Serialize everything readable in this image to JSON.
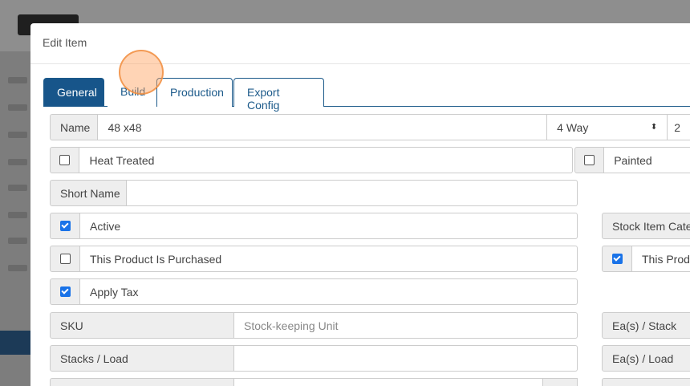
{
  "modal": {
    "title": "Edit Item"
  },
  "tabs": [
    {
      "label": "General",
      "active": true
    },
    {
      "label": "Build",
      "active": false
    },
    {
      "label": "Production",
      "active": false
    },
    {
      "label": "Export Config",
      "active": false
    }
  ],
  "form": {
    "name_label": "Name",
    "name_value": "48 x48",
    "type_select": "4 Way",
    "extra_value": "2",
    "heat_treated_label": "Heat Treated",
    "heat_treated_checked": false,
    "painted_label": "Painted",
    "painted_checked": false,
    "short_name_label": "Short Name",
    "short_name_value": "",
    "active_label": "Active",
    "active_checked": true,
    "stock_item_category_label": "Stock Item Categ",
    "purchased_label": "This Product Is Purchased",
    "purchased_checked": false,
    "this_product_right_label": "This Produ",
    "this_product_right_checked": true,
    "apply_tax_label": "Apply Tax",
    "apply_tax_checked": true,
    "sku_label": "SKU",
    "sku_placeholder": "Stock-keeping Unit",
    "eas_stack_label": "Ea(s) / Stack",
    "stacks_load_label": "Stacks / Load",
    "stacks_load_value": "",
    "eas_load_label": "Ea(s) / Load"
  },
  "colors": {
    "primary": "#17558a",
    "checkbox": "#1a73e8",
    "highlight": "#f5a05a"
  }
}
